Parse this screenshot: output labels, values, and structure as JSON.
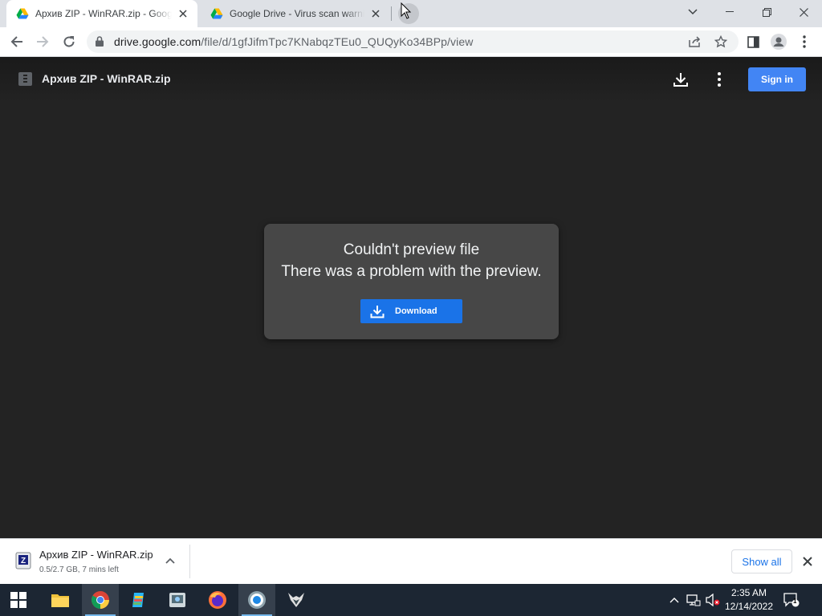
{
  "browser": {
    "tabs": [
      {
        "title": "Архив ZIP - WinRAR.zip - Google Drive",
        "close_icon": "close-icon"
      },
      {
        "title": "Google Drive - Virus scan warning",
        "close_icon": "close-icon"
      }
    ],
    "address_bar": {
      "domain": "drive.google.com",
      "path": "/file/d/1gfJifmTpc7KNabqzTEu0_QUQyKo34BPp/view"
    }
  },
  "viewer": {
    "file_name": "Архив ZIP - WinRAR.zip",
    "sign_in_label": "Sign in",
    "error": {
      "title": "Couldn't preview file",
      "message": "There was a problem with the preview.",
      "download_label": "Download"
    }
  },
  "download_shelf": {
    "file_name": "Архив ZIP - WinRAR.zip",
    "status": "0.5/2.7 GB, 7 mins left",
    "show_all_label": "Show all"
  },
  "taskbar": {
    "time": "2:35 AM",
    "date": "12/14/2022",
    "notification_count": "1"
  },
  "colors": {
    "accent_blue": "#1a73e8",
    "signin_blue": "#4285f4",
    "viewer_bg": "#232323",
    "card_bg": "#474747",
    "taskbar_bg": "#1c2633"
  }
}
